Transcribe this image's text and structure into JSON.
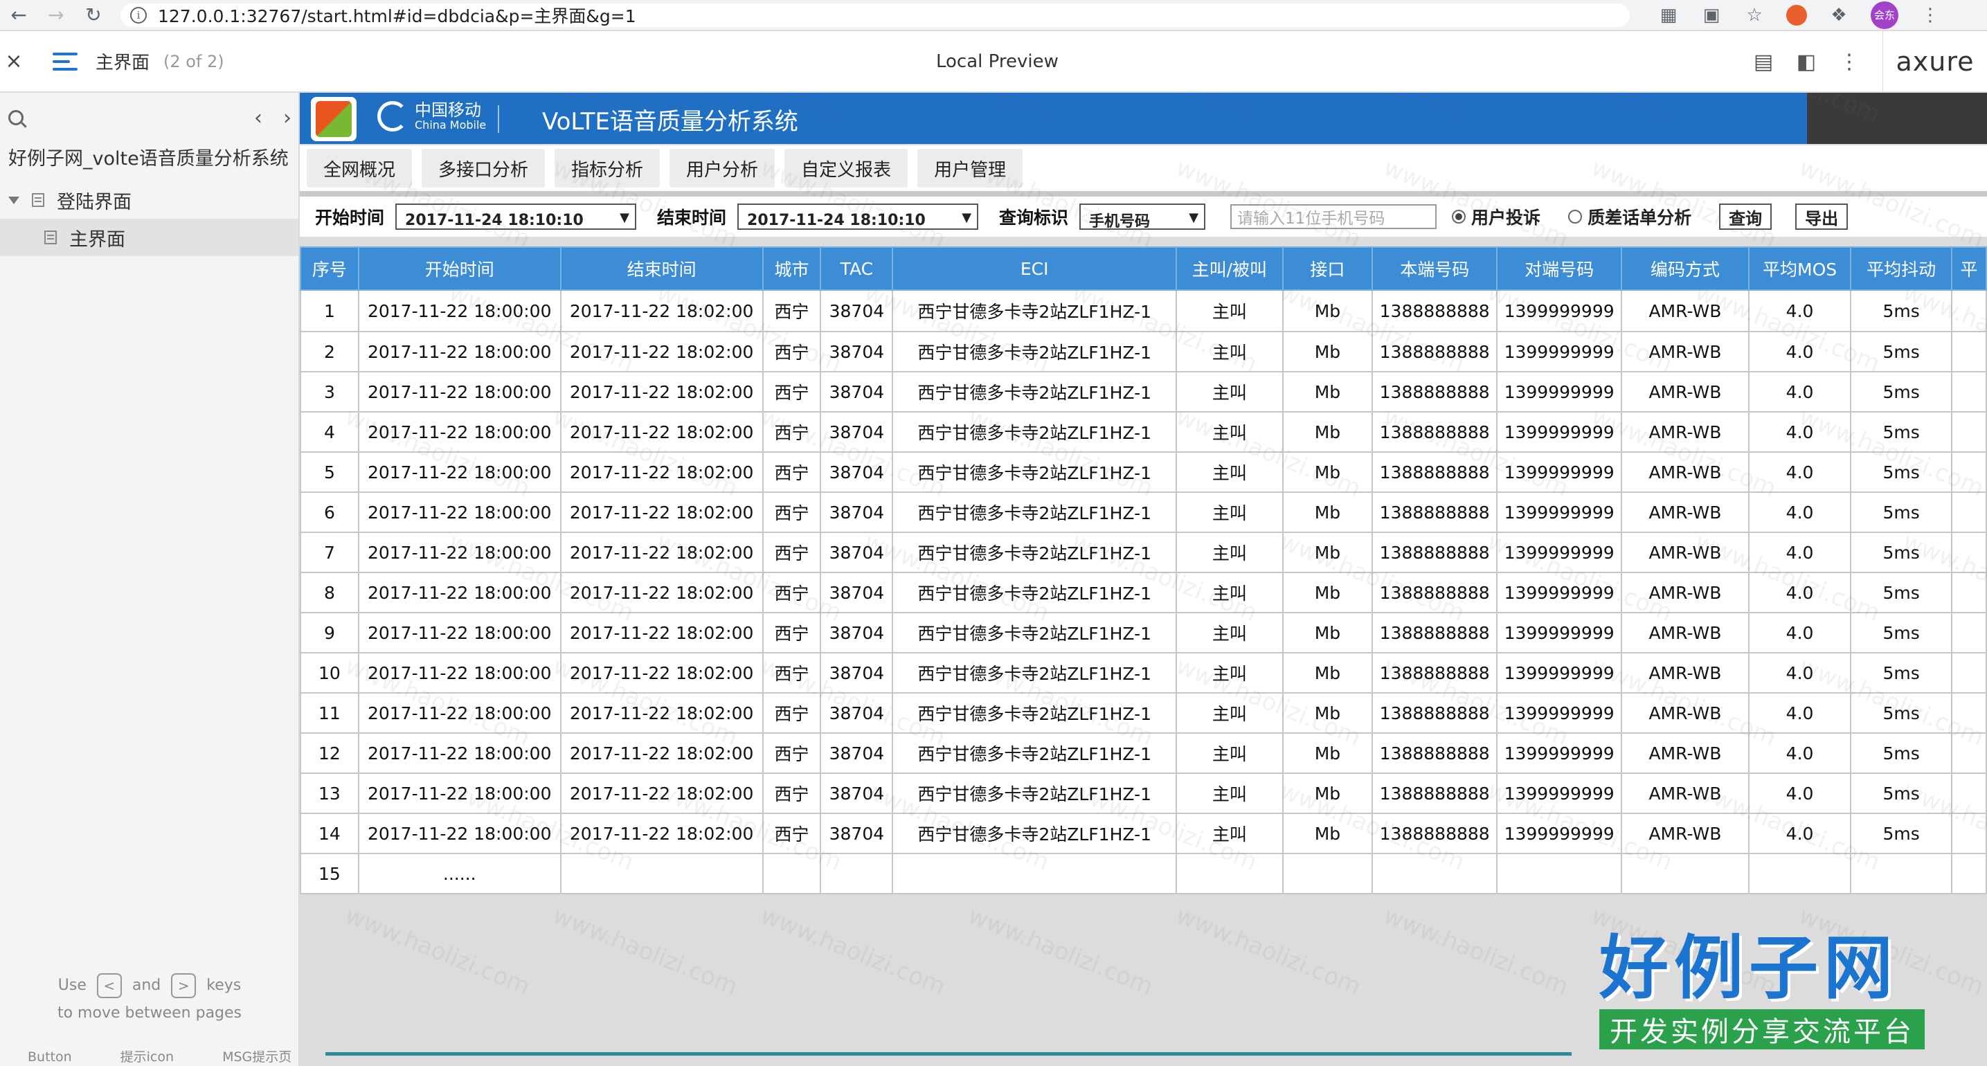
{
  "browser": {
    "url": "127.0.0.1:32767/start.html#id=dbdcia&p=主界面&g=1",
    "avatar_text": "会东"
  },
  "axure": {
    "page_title": "主界面",
    "page_count": "(2 of 2)",
    "center_title": "Local Preview",
    "logo": "axure"
  },
  "sidebar": {
    "project": "好例子网_volte语音质量分析系统",
    "tree": [
      {
        "label": "登陆界面"
      },
      {
        "label": "主界面"
      }
    ],
    "hint_use": "Use",
    "hint_and": "and",
    "hint_keys": "keys",
    "hint_move": "to move between pages",
    "key_prev": "<",
    "key_next": ">",
    "bottom_strip": [
      "Button",
      "提示icon",
      "MSG提示页"
    ]
  },
  "app": {
    "logo_brand_cn": "中国移动",
    "logo_brand_en": "China Mobile",
    "title": "VoLTE语音质量分析系统",
    "menu": [
      "全网概况",
      "多接口分析",
      "指标分析",
      "用户分析",
      "自定义报表",
      "用户管理"
    ],
    "filter": {
      "start_label": "开始时间",
      "start_value": "2017-11-24 18:10:10",
      "end_label": "结束时间",
      "end_value": "2017-11-24 18:10:10",
      "query_label": "查询标识",
      "query_value": "手机号码",
      "phone_placeholder": "请输入11位手机号码",
      "radio_complaint": "用户投诉",
      "radio_poor": "质差话单分析",
      "btn_query": "查询",
      "btn_export": "导出"
    },
    "table": {
      "columns": [
        "序号",
        "开始时间",
        "结束时间",
        "城市",
        "TAC",
        "ECI",
        "主叫/被叫",
        "接口",
        "本端号码",
        "对端号码",
        "编码方式",
        "平均MOS",
        "平均抖动",
        "平"
      ],
      "rows": [
        [
          "1",
          "2017-11-22 18:00:00",
          "2017-11-22 18:02:00",
          "西宁",
          "38704",
          "西宁甘德多卡寺2站ZLF1HZ-1",
          "主叫",
          "Mb",
          "1388888888",
          "1399999999",
          "AMR-WB",
          "4.0",
          "5ms",
          ""
        ],
        [
          "2",
          "2017-11-22 18:00:00",
          "2017-11-22 18:02:00",
          "西宁",
          "38704",
          "西宁甘德多卡寺2站ZLF1HZ-1",
          "主叫",
          "Mb",
          "1388888888",
          "1399999999",
          "AMR-WB",
          "4.0",
          "5ms",
          ""
        ],
        [
          "3",
          "2017-11-22 18:00:00",
          "2017-11-22 18:02:00",
          "西宁",
          "38704",
          "西宁甘德多卡寺2站ZLF1HZ-1",
          "主叫",
          "Mb",
          "1388888888",
          "1399999999",
          "AMR-WB",
          "4.0",
          "5ms",
          ""
        ],
        [
          "4",
          "2017-11-22 18:00:00",
          "2017-11-22 18:02:00",
          "西宁",
          "38704",
          "西宁甘德多卡寺2站ZLF1HZ-1",
          "主叫",
          "Mb",
          "1388888888",
          "1399999999",
          "AMR-WB",
          "4.0",
          "5ms",
          ""
        ],
        [
          "5",
          "2017-11-22 18:00:00",
          "2017-11-22 18:02:00",
          "西宁",
          "38704",
          "西宁甘德多卡寺2站ZLF1HZ-1",
          "主叫",
          "Mb",
          "1388888888",
          "1399999999",
          "AMR-WB",
          "4.0",
          "5ms",
          ""
        ],
        [
          "6",
          "2017-11-22 18:00:00",
          "2017-11-22 18:02:00",
          "西宁",
          "38704",
          "西宁甘德多卡寺2站ZLF1HZ-1",
          "主叫",
          "Mb",
          "1388888888",
          "1399999999",
          "AMR-WB",
          "4.0",
          "5ms",
          ""
        ],
        [
          "7",
          "2017-11-22 18:00:00",
          "2017-11-22 18:02:00",
          "西宁",
          "38704",
          "西宁甘德多卡寺2站ZLF1HZ-1",
          "主叫",
          "Mb",
          "1388888888",
          "1399999999",
          "AMR-WB",
          "4.0",
          "5ms",
          ""
        ],
        [
          "8",
          "2017-11-22 18:00:00",
          "2017-11-22 18:02:00",
          "西宁",
          "38704",
          "西宁甘德多卡寺2站ZLF1HZ-1",
          "主叫",
          "Mb",
          "1388888888",
          "1399999999",
          "AMR-WB",
          "4.0",
          "5ms",
          ""
        ],
        [
          "9",
          "2017-11-22 18:00:00",
          "2017-11-22 18:02:00",
          "西宁",
          "38704",
          "西宁甘德多卡寺2站ZLF1HZ-1",
          "主叫",
          "Mb",
          "1388888888",
          "1399999999",
          "AMR-WB",
          "4.0",
          "5ms",
          ""
        ],
        [
          "10",
          "2017-11-22 18:00:00",
          "2017-11-22 18:02:00",
          "西宁",
          "38704",
          "西宁甘德多卡寺2站ZLF1HZ-1",
          "主叫",
          "Mb",
          "1388888888",
          "1399999999",
          "AMR-WB",
          "4.0",
          "5ms",
          ""
        ],
        [
          "11",
          "2017-11-22 18:00:00",
          "2017-11-22 18:02:00",
          "西宁",
          "38704",
          "西宁甘德多卡寺2站ZLF1HZ-1",
          "主叫",
          "Mb",
          "1388888888",
          "1399999999",
          "AMR-WB",
          "4.0",
          "5ms",
          ""
        ],
        [
          "12",
          "2017-11-22 18:00:00",
          "2017-11-22 18:02:00",
          "西宁",
          "38704",
          "西宁甘德多卡寺2站ZLF1HZ-1",
          "主叫",
          "Mb",
          "1388888888",
          "1399999999",
          "AMR-WB",
          "4.0",
          "5ms",
          ""
        ],
        [
          "13",
          "2017-11-22 18:00:00",
          "2017-11-22 18:02:00",
          "西宁",
          "38704",
          "西宁甘德多卡寺2站ZLF1HZ-1",
          "主叫",
          "Mb",
          "1388888888",
          "1399999999",
          "AMR-WB",
          "4.0",
          "5ms",
          ""
        ],
        [
          "14",
          "2017-11-22 18:00:00",
          "2017-11-22 18:02:00",
          "西宁",
          "38704",
          "西宁甘德多卡寺2站ZLF1HZ-1",
          "主叫",
          "Mb",
          "1388888888",
          "1399999999",
          "AMR-WB",
          "4.0",
          "5ms",
          ""
        ],
        [
          "15",
          "......",
          "",
          "",
          "",
          "",
          "",
          "",
          "",
          "",
          "",
          "",
          "",
          ""
        ]
      ]
    }
  },
  "watermark": "www.haolizi.com",
  "brand": {
    "main": "好例子网",
    "sub": "开发实例分享交流平台"
  },
  "colors": {
    "header_blue": "#1f6fc5",
    "table_header": "#3d8cd6",
    "brand_blue": "#1a74d0",
    "brand_green": "#2aa14a"
  }
}
